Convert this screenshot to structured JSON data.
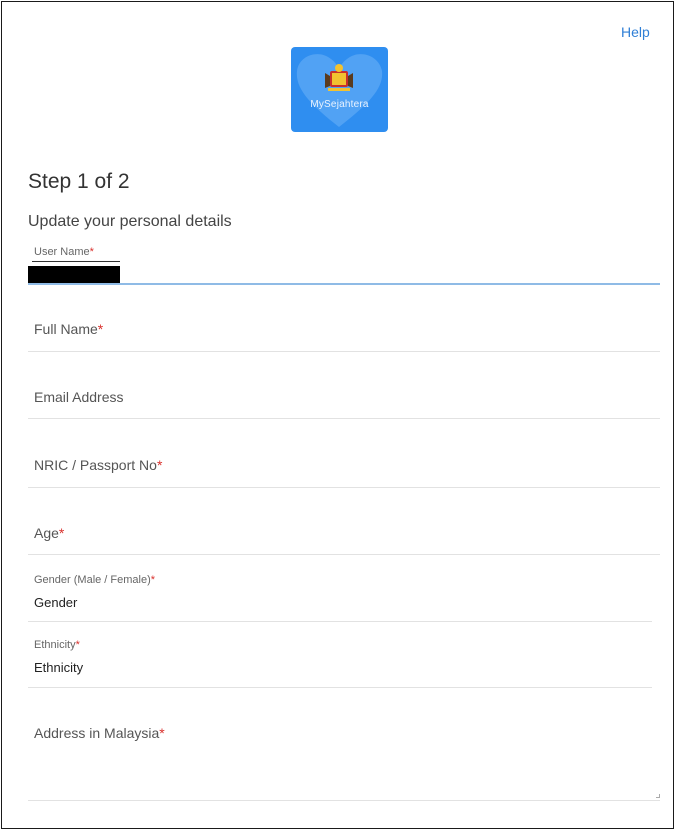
{
  "header": {
    "help_label": "Help",
    "logo_text": "MySejahtera",
    "logo_color": "#2f8ef0"
  },
  "form": {
    "step_title": "Step 1 of 2",
    "subtitle": "Update your personal details",
    "required_marker": "*",
    "fields": {
      "username": {
        "label": "User Name",
        "value": ""
      },
      "fullname": {
        "label": "Full Name",
        "value": ""
      },
      "email": {
        "label": "Email Address",
        "value": ""
      },
      "nric": {
        "label": "NRIC / Passport No",
        "value": ""
      },
      "age": {
        "label": "Age",
        "value": ""
      },
      "gender": {
        "label": "Gender (Male / Female)",
        "value": "Gender"
      },
      "ethnicity": {
        "label": "Ethnicity",
        "value": "Ethnicity"
      },
      "address": {
        "label": "Address in Malaysia",
        "value": ""
      }
    }
  },
  "colors": {
    "accent": "#2f7fd6",
    "required": "#d9302c",
    "active_underline": "#8fbbe6"
  }
}
